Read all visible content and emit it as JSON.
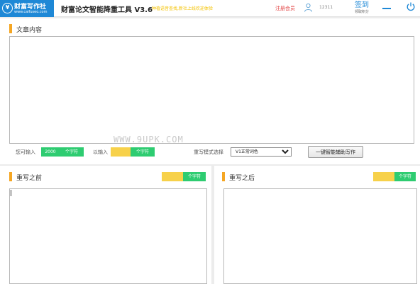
{
  "header": {
    "logo_title": "财富写作社",
    "logo_sub": "www.caifuseo.com",
    "app_title": "财富论文智能降重工具 V3.6",
    "slogan": "种植语音查找,新社上线欢迎体验",
    "register": "注册会员",
    "user_id": "12311",
    "signin": "签到",
    "signin_sub": "领取积分"
  },
  "article": {
    "title": "文章内容",
    "text": "",
    "remaining_label": "您可输入",
    "remaining_value": "2000",
    "remaining_unit": "个字符",
    "entered_label": "以输入",
    "entered_value": "",
    "entered_unit": "个字符",
    "mode_label": "重写模式选择",
    "mode_value": "V1正常词色",
    "assist_button": "一键智能辅助写作"
  },
  "before": {
    "title": "重写之前",
    "count_value": "",
    "count_unit": "个字符",
    "text": ""
  },
  "after": {
    "title": "重写之后",
    "count_value": "",
    "count_unit": "个字符",
    "text": ""
  },
  "watermark": "WWW.9UPK.COM",
  "colors": {
    "accent": "#1e88d6",
    "section_bar": "#f5a623",
    "count_green": "#2ecc71",
    "count_yellow": "#f7d14a",
    "register_red": "#e03a3a",
    "slogan_yellow": "#f4c200"
  }
}
